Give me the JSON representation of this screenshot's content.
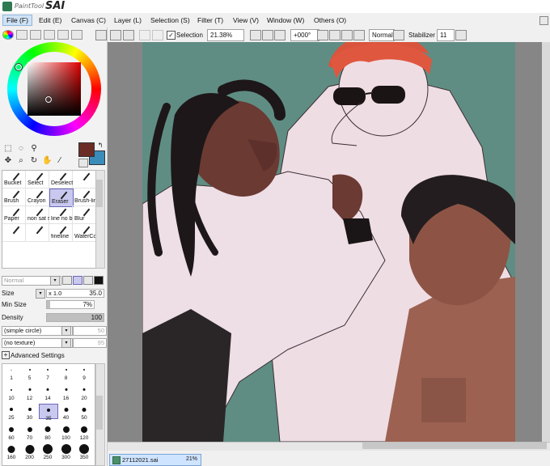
{
  "app": {
    "brand_small": "PaintTool",
    "brand_big": "SAI"
  },
  "menu": [
    {
      "label": "File (F)",
      "active": true
    },
    {
      "label": "Edit (E)"
    },
    {
      "label": "Canvas (C)"
    },
    {
      "label": "Layer (L)"
    },
    {
      "label": "Selection (S)"
    },
    {
      "label": "Filter (T)"
    },
    {
      "label": "View (V)"
    },
    {
      "label": "Window (W)"
    },
    {
      "label": "Others (O)"
    }
  ],
  "toolbar": {
    "selection_label": "Selection",
    "zoom": "21.38%",
    "rotation": "+000°",
    "blend_mode": "Normal",
    "stabilizer_label": "Stabilizer",
    "stabilizer_value": "11"
  },
  "colors": {
    "main": "#6b2c26",
    "sub": "#3a8dba",
    "accent_selected": "#c9c8ef"
  },
  "brushes": [
    {
      "label": "Bucket"
    },
    {
      "label": "Select"
    },
    {
      "label": "Deselect"
    },
    {
      "label": ""
    },
    {
      "label": "Brush"
    },
    {
      "label": "Crayon"
    },
    {
      "label": "Eraser",
      "selected": true
    },
    {
      "label": "Brush-lin"
    },
    {
      "label": "Paper"
    },
    {
      "label": "non sat solid co"
    },
    {
      "label": "line no b"
    },
    {
      "label": "Blur"
    },
    {
      "label": ""
    },
    {
      "label": ""
    },
    {
      "label": "fineline"
    },
    {
      "label": "WaterCo"
    }
  ],
  "blend": {
    "mode_placeholder": "Normal"
  },
  "properties": {
    "size_label": "Size",
    "size_mult": "x 1.0",
    "size_value": "35.0",
    "min_size_label": "Min Size",
    "min_size_value": "7%",
    "min_size_fraction": 0.07,
    "density_label": "Density",
    "density_value": "100",
    "density_fraction": 1.0,
    "shape": "(simple circle)",
    "shape_value": "50",
    "texture": "(no texture)",
    "texture_value": "95",
    "advanced_label": "Advanced Settings"
  },
  "brush_sizes": [
    "1",
    "5",
    "7",
    "8",
    "9",
    "10",
    "12",
    "14",
    "16",
    "20",
    "25",
    "30",
    "35",
    "40",
    "50",
    "60",
    "70",
    "80",
    "100",
    "120",
    "160",
    "200",
    "250",
    "300",
    "350"
  ],
  "brush_size_selected": "35",
  "status": {
    "filename": "27112021.sai",
    "zoom": "21%"
  }
}
